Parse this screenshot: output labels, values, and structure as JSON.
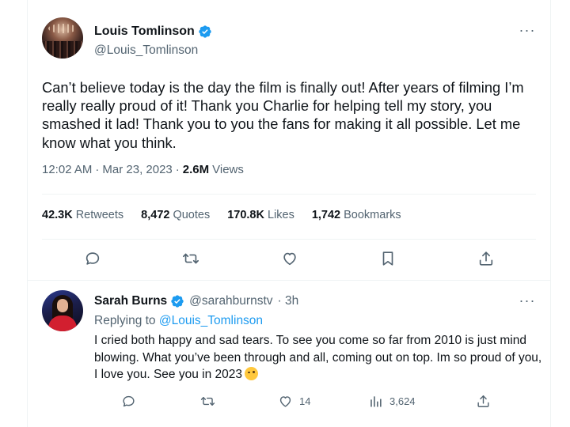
{
  "main_tweet": {
    "author_name": "Louis Tomlinson",
    "author_handle": "@Louis_Tomlinson",
    "text": "Can’t believe today is the day the film is finally out! After years of filming I’m really really proud of it! Thank you Charlie for helping tell my story, you smashed it lad! Thank you to you the fans for making it all possible. Let me know what you think.",
    "time": "12:02 AM",
    "separator": "·",
    "date": "Mar 23, 2023",
    "views_count": "2.6M",
    "views_label": "Views",
    "stats": [
      {
        "count": "42.3K",
        "label": "Retweets"
      },
      {
        "count": "8,472",
        "label": "Quotes"
      },
      {
        "count": "170.8K",
        "label": "Likes"
      },
      {
        "count": "1,742",
        "label": "Bookmarks"
      }
    ],
    "actions": [
      "reply-icon",
      "retweet-icon",
      "like-icon",
      "bookmark-icon",
      "share-icon"
    ]
  },
  "reply": {
    "author_name": "Sarah Burns",
    "author_handle": "@sarahburnstv",
    "time_ago": "· 3h",
    "replying_to_prefix": "Replying to",
    "replying_to_handle": "@Louis_Tomlinson",
    "text": "I cried both happy and sad tears. To see you come so far from 2010 is just mind blowing. What you’ve been through and all, coming out on top. Im so proud of you, I love you. See you in 2023",
    "emoji": "winking-face-emoji",
    "like_count": "14",
    "views_count": "3,624"
  },
  "colors": {
    "text_primary": "#0f1419",
    "text_secondary": "#536471",
    "accent": "#1d9bf0",
    "divider": "#eff3f4"
  }
}
